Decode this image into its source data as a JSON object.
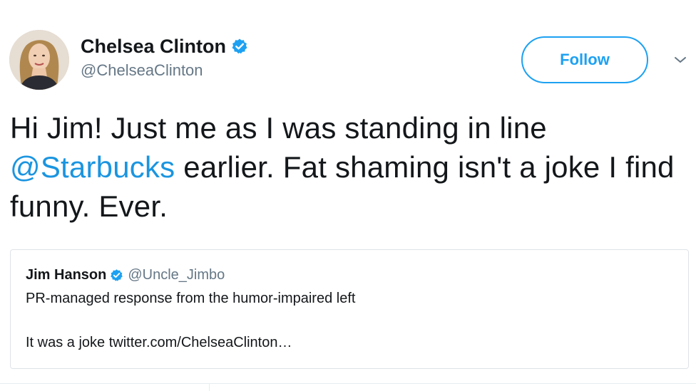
{
  "tweet": {
    "author": {
      "display_name": "Chelsea Clinton",
      "handle": "@ChelseaClinton",
      "verified_icon": "verified-badge-icon"
    },
    "follow_label": "Follow",
    "caret_icon": "chevron-down-icon",
    "text": {
      "part1": "Hi Jim! Just me as I was standing in line ",
      "mention": "@Starbucks",
      "part2": " earlier. Fat shaming isn't a joke I find funny. Ever."
    },
    "quoted": {
      "display_name": "Jim Hanson",
      "handle": "@Uncle_Jimbo",
      "line1": "PR-managed response from the humor-impaired left",
      "line2": "It was a joke twitter.com/ChelseaClinton…"
    }
  },
  "colors": {
    "accent": "#1da1f2",
    "link": "#1b95e0",
    "secondary_text": "#657786",
    "primary_text": "#14171a",
    "border": "#dfe3e7"
  }
}
